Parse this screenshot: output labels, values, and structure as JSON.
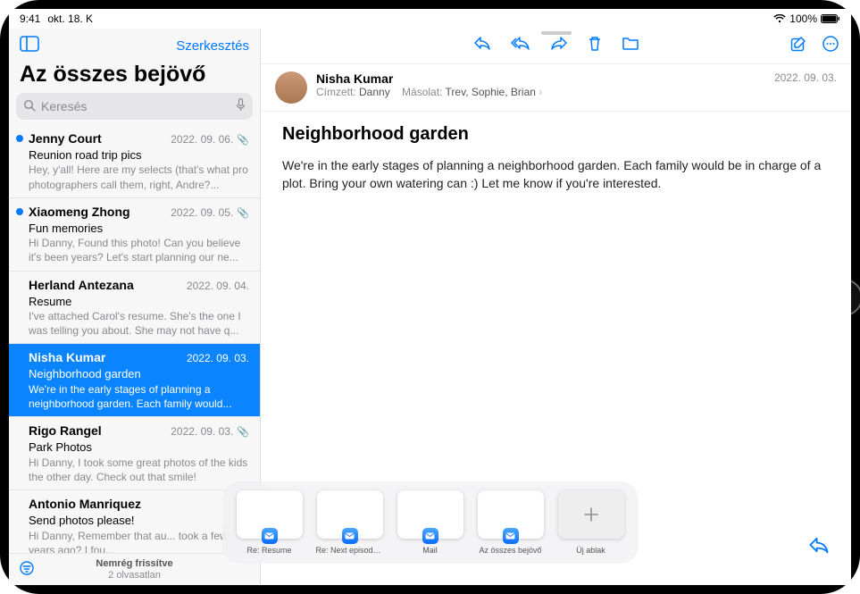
{
  "status": {
    "time": "9:41",
    "date": "okt. 18. K",
    "battery_pct": "100%"
  },
  "sidebar": {
    "edit_label": "Szerkesztés",
    "title": "Az összes bejövő",
    "search_placeholder": "Keresés",
    "footer_line1": "Nemrég frissítve",
    "footer_line2": "2 olvasatlan"
  },
  "emails": [
    {
      "sender": "Jenny Court",
      "date": "2022. 09. 06.",
      "subject": "Reunion road trip pics",
      "preview": "Hey, y'all! Here are my selects (that's what pro photographers call them, right, Andre?...",
      "unread": true,
      "attachment": true,
      "selected": false
    },
    {
      "sender": "Xiaomeng Zhong",
      "date": "2022. 09. 05.",
      "subject": "Fun memories",
      "preview": "Hi Danny, Found this photo! Can you believe it's been years? Let's start planning our ne...",
      "unread": true,
      "attachment": true,
      "selected": false
    },
    {
      "sender": "Herland Antezana",
      "date": "2022. 09. 04.",
      "subject": "Resume",
      "preview": "I've attached Carol's resume. She's the one I was telling you about. She may not have q...",
      "unread": false,
      "attachment": false,
      "selected": false
    },
    {
      "sender": "Nisha Kumar",
      "date": "2022. 09. 03.",
      "subject": "Neighborhood garden",
      "preview": "We're in the early stages of planning a neighborhood garden. Each family would...",
      "unread": false,
      "attachment": false,
      "selected": true
    },
    {
      "sender": "Rigo Rangel",
      "date": "2022. 09. 03.",
      "subject": "Park Photos",
      "preview": "Hi Danny, I took some great photos of the kids the other day. Check out that smile!",
      "unread": false,
      "attachment": true,
      "selected": false
    },
    {
      "sender": "Antonio Manriquez",
      "date": "",
      "subject": "Send photos please!",
      "preview": "Hi Danny, Remember that au... took a few years ago? I fou...",
      "unread": false,
      "attachment": false,
      "selected": false
    }
  ],
  "message": {
    "from": "Nisha Kumar",
    "to_label": "Címzett:",
    "to_name": "Danny",
    "cc_label": "Másolat:",
    "cc_names": "Trev, Sophie, Brian",
    "date": "2022. 09. 03.",
    "subject": "Neighborhood garden",
    "body": "We're in the early stages of planning a neighborhood garden. Each family would be in charge of a plot. Bring your own watering can :) Let me know if you're interested."
  },
  "shelf": {
    "items": [
      {
        "label": "Re: Resume"
      },
      {
        "label": "Re: Next episode's g..."
      },
      {
        "label": "Mail"
      },
      {
        "label": "Az összes bejövő"
      }
    ],
    "new_label": "Új ablak"
  }
}
